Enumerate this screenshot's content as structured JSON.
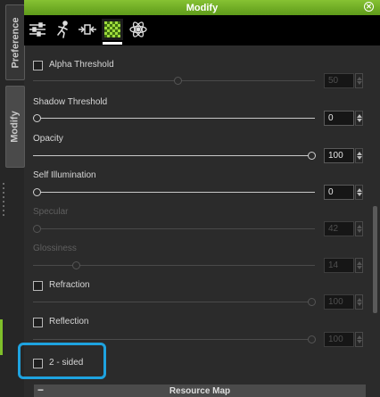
{
  "window": {
    "title": "Modify"
  },
  "side_tabs": {
    "preference": "Preference",
    "modify": "Modify"
  },
  "toolbar": {
    "icons": [
      "sliders-icon",
      "motion-icon",
      "edit-transform-icon",
      "material-checker-icon",
      "physics-atom-icon"
    ],
    "active_index": 3
  },
  "params": {
    "alpha_threshold": {
      "label": "Alpha Threshold",
      "value": "50",
      "checked": false,
      "enabled": false
    },
    "shadow_threshold": {
      "label": "Shadow Threshold",
      "value": "0"
    },
    "opacity": {
      "label": "Opacity",
      "value": "100"
    },
    "self_illumination": {
      "label": "Self Illumination",
      "value": "0"
    },
    "specular": {
      "label": "Specular",
      "value": "42",
      "enabled": false
    },
    "glossiness": {
      "label": "Glossiness",
      "value": "14",
      "enabled": false
    },
    "refraction": {
      "label": "Refraction",
      "value": "100",
      "checked": false
    },
    "reflection": {
      "label": "Reflection",
      "value": "100",
      "checked": false
    },
    "two_sided": {
      "label": "2 - sided",
      "checked": false
    }
  },
  "resource_map": {
    "label": "Resource Map",
    "collapse_symbol": "−"
  },
  "colors": {
    "accent": "#7fbf2a",
    "highlight": "#1ea3e0"
  }
}
